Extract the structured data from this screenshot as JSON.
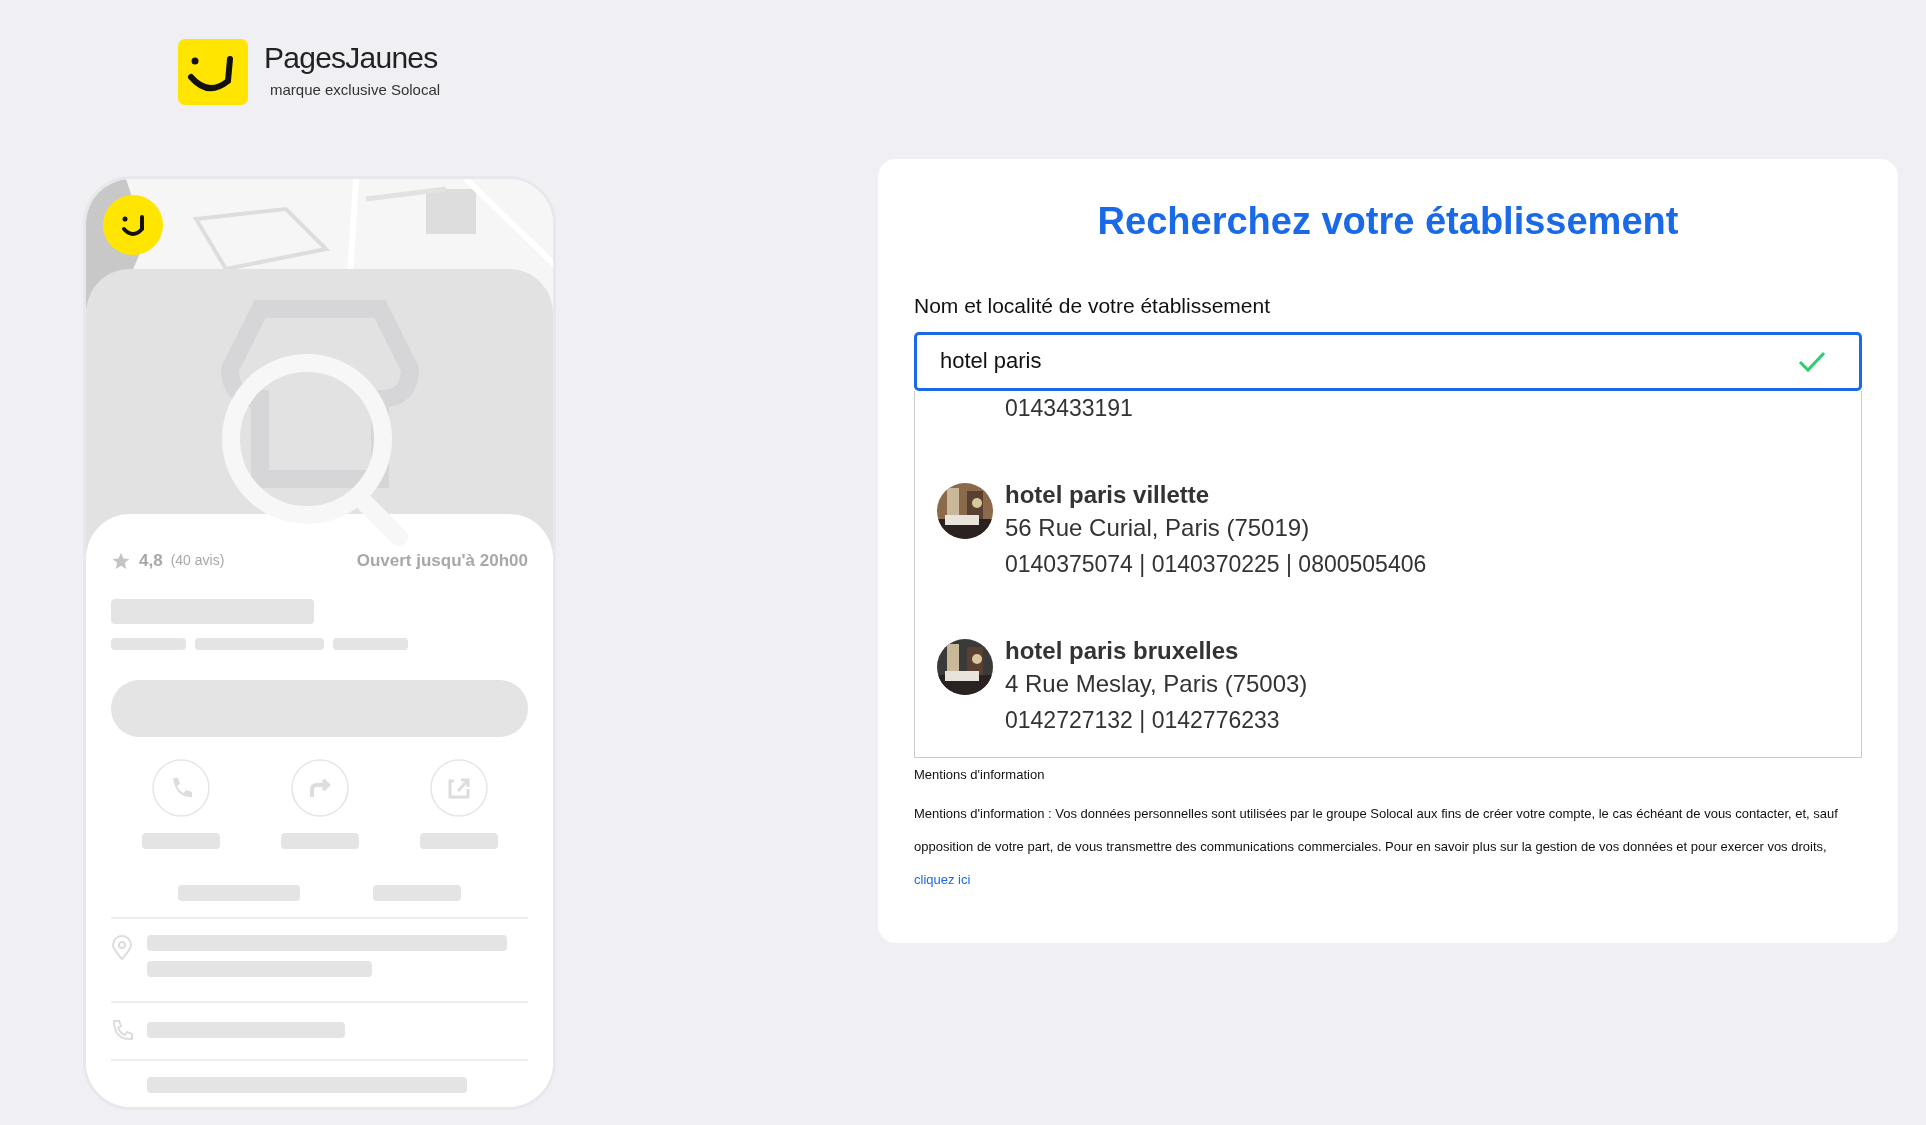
{
  "brand": {
    "name": "PagesJaunes",
    "tagline": "marque exclusive Solocal"
  },
  "preview": {
    "rating": "4,8",
    "reviews": "(40 avis)",
    "hours": "Ouvert jusqu'à 20h00"
  },
  "search": {
    "title": "Recherchez votre établissement",
    "label": "Nom et localité de votre établissement",
    "value": "hotel paris",
    "valid": true,
    "results": [
      {
        "phones": "0143433191"
      },
      {
        "kind": "picture",
        "name": "hotel paris villette",
        "address": "56 Rue Curial, Paris (75019)",
        "phones": "0140375074 | 0140370225 | 0800505406"
      },
      {
        "kind": "picture",
        "name": "hotel paris bruxelles",
        "address": "4 Rue Meslay, Paris (75003)",
        "phones": "0142727132 | 0142776233"
      }
    ]
  },
  "legal": {
    "heading": "Mentions d'information",
    "text": "Mentions d'information : Vos données personnelles sont utilisées par le groupe Solocal aux fins de créer votre compte, le cas échéant de vous contacter, et, sauf opposition de votre part, de vous transmettre des communications commerciales. Pour en savoir plus sur la gestion de vos données et pour exercer vos droits,",
    "link": "cliquez ici"
  }
}
